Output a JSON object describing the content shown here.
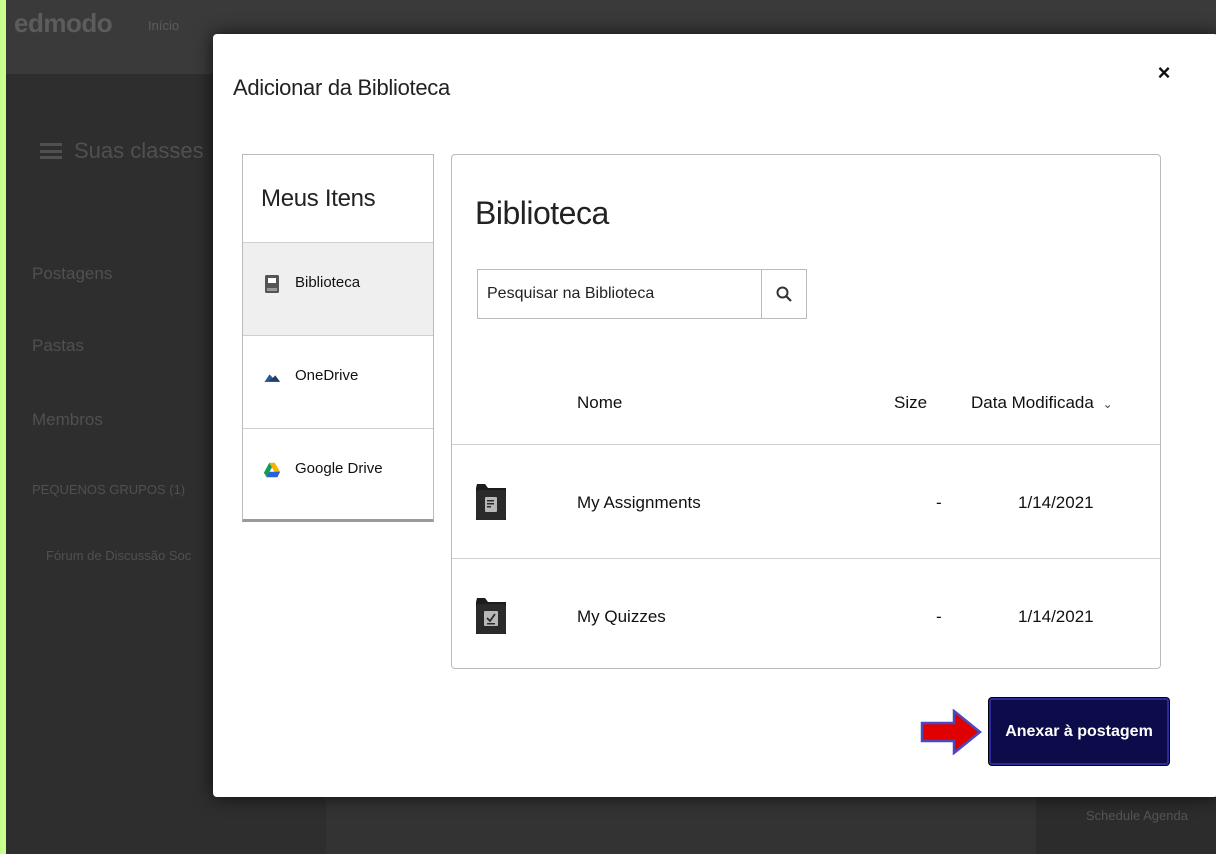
{
  "background": {
    "logo": "edmodo",
    "nav_inicio": "Início",
    "classes_label": "Suas classes",
    "nav_items": [
      "Postagens",
      "Pastas",
      "Membros",
      "PEQUENOS GRUPOS (1)"
    ],
    "group_item": "Fórum de Discussão Soc",
    "schedule": "Schedule Agenda"
  },
  "modal": {
    "title": "Adicionar da Biblioteca",
    "close": "×",
    "sources_header": "Meus Itens",
    "sources": [
      {
        "label": "Biblioteca",
        "icon": "library-icon",
        "active": true
      },
      {
        "label": "OneDrive",
        "icon": "onedrive-icon",
        "active": false
      },
      {
        "label": "Google Drive",
        "icon": "google-drive-icon",
        "active": false
      }
    ],
    "panel_title": "Biblioteca",
    "search": {
      "value": "Pesquisar na Biblioteca",
      "icon": "search-icon"
    },
    "columns": {
      "name": "Nome",
      "size": "Size",
      "date": "Data Modificada",
      "sort_icon": "⌄"
    },
    "rows": [
      {
        "name": "My Assignments",
        "size": "-",
        "date": "1/14/2021",
        "icon": "assignment-folder-icon"
      },
      {
        "name": "My Quizzes",
        "size": "-",
        "date": "1/14/2021",
        "icon": "quiz-folder-icon"
      }
    ],
    "attach_button": "Anexar à postagem"
  },
  "colors": {
    "frame": "#c9ff8f",
    "button": "#0c0c4a",
    "arrow": "#e00000"
  }
}
